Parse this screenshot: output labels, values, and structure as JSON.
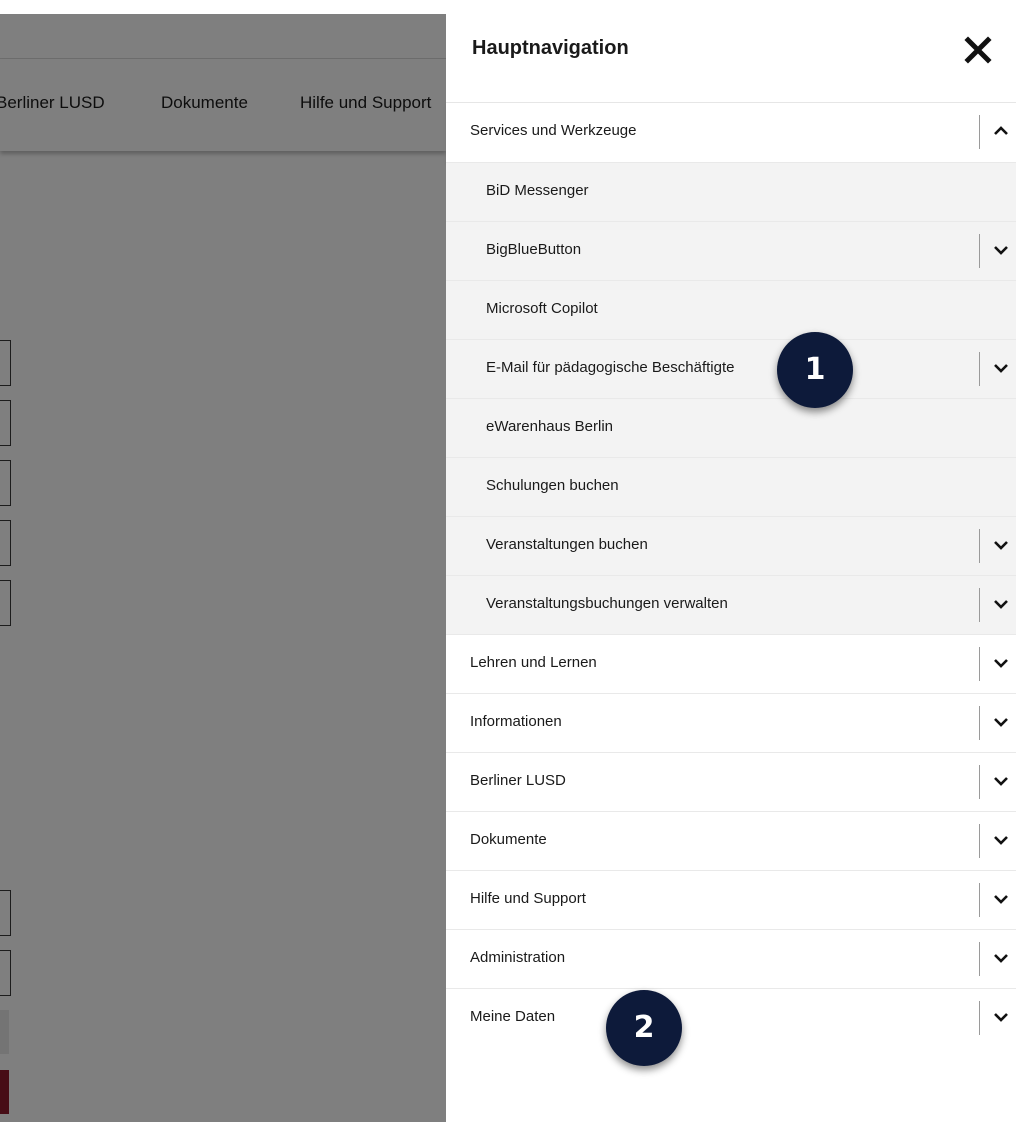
{
  "background_nav": {
    "items": [
      "Berliner LUSD",
      "Dokumente",
      "Hilfe und Support"
    ]
  },
  "drawer": {
    "title": "Hauptnavigation",
    "close_icon": "close-x-icon",
    "expanded_section": {
      "label": "Services und Werkzeuge",
      "items": [
        {
          "label": "BiD Messenger",
          "has_children": false
        },
        {
          "label": "BigBlueButton",
          "has_children": true
        },
        {
          "label": "Microsoft Copilot",
          "has_children": false
        },
        {
          "label": "E-Mail für pädagogische Beschäftigte",
          "has_children": true
        },
        {
          "label": "eWarenhaus Berlin",
          "has_children": false
        },
        {
          "label": "Schulungen buchen",
          "has_children": false
        },
        {
          "label": "Veranstaltungen buchen",
          "has_children": true
        },
        {
          "label": "Veranstaltungsbuchungen verwalten",
          "has_children": true
        }
      ]
    },
    "sections": [
      {
        "label": "Lehren und Lernen"
      },
      {
        "label": "Informationen"
      },
      {
        "label": "Berliner LUSD"
      },
      {
        "label": "Dokumente"
      },
      {
        "label": "Hilfe und Support"
      },
      {
        "label": "Administration"
      },
      {
        "label": "Meine Daten"
      }
    ]
  },
  "badges": [
    "1",
    "2"
  ],
  "colors": {
    "overlay": "#808080",
    "badge": "#0d1a3a",
    "submenu_bg": "#f3f3f3",
    "accent_red": "#8e1b2c"
  }
}
